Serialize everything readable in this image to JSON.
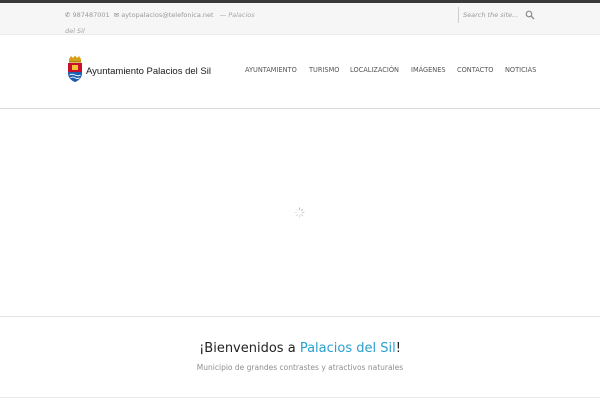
{
  "topbar": {
    "phone": "987487001",
    "email": "aytopalacios@telefonica.net",
    "separator": "—",
    "place_line1": "Palacios",
    "place_line2": "del Sil",
    "search_placeholder": "Search the site...",
    "icons": {
      "phone": "phone-icon",
      "email": "envelope-icon",
      "search": "search-icon"
    }
  },
  "header": {
    "logo_text": "Ayuntamiento Palacios del Sil",
    "nav": [
      {
        "label": "AYUNTAMIENTO"
      },
      {
        "label": "TURISMO"
      },
      {
        "label": "LOCALIZACIÓN"
      },
      {
        "label": "IMÁGENES"
      },
      {
        "label": "CONTACTO"
      },
      {
        "label": "NOTICIAS"
      }
    ]
  },
  "welcome": {
    "prefix": "¡Bienvenidos a ",
    "highlight": "Palacios del Sil",
    "suffix": "!",
    "subtitle": "Municipio de grandes contrastes y atractivos naturales"
  },
  "colors": {
    "accent": "#2b9fd0",
    "top_strip": "#3a3a3a",
    "topbar_bg": "#f6f6f6",
    "nav_text": "#555555"
  }
}
